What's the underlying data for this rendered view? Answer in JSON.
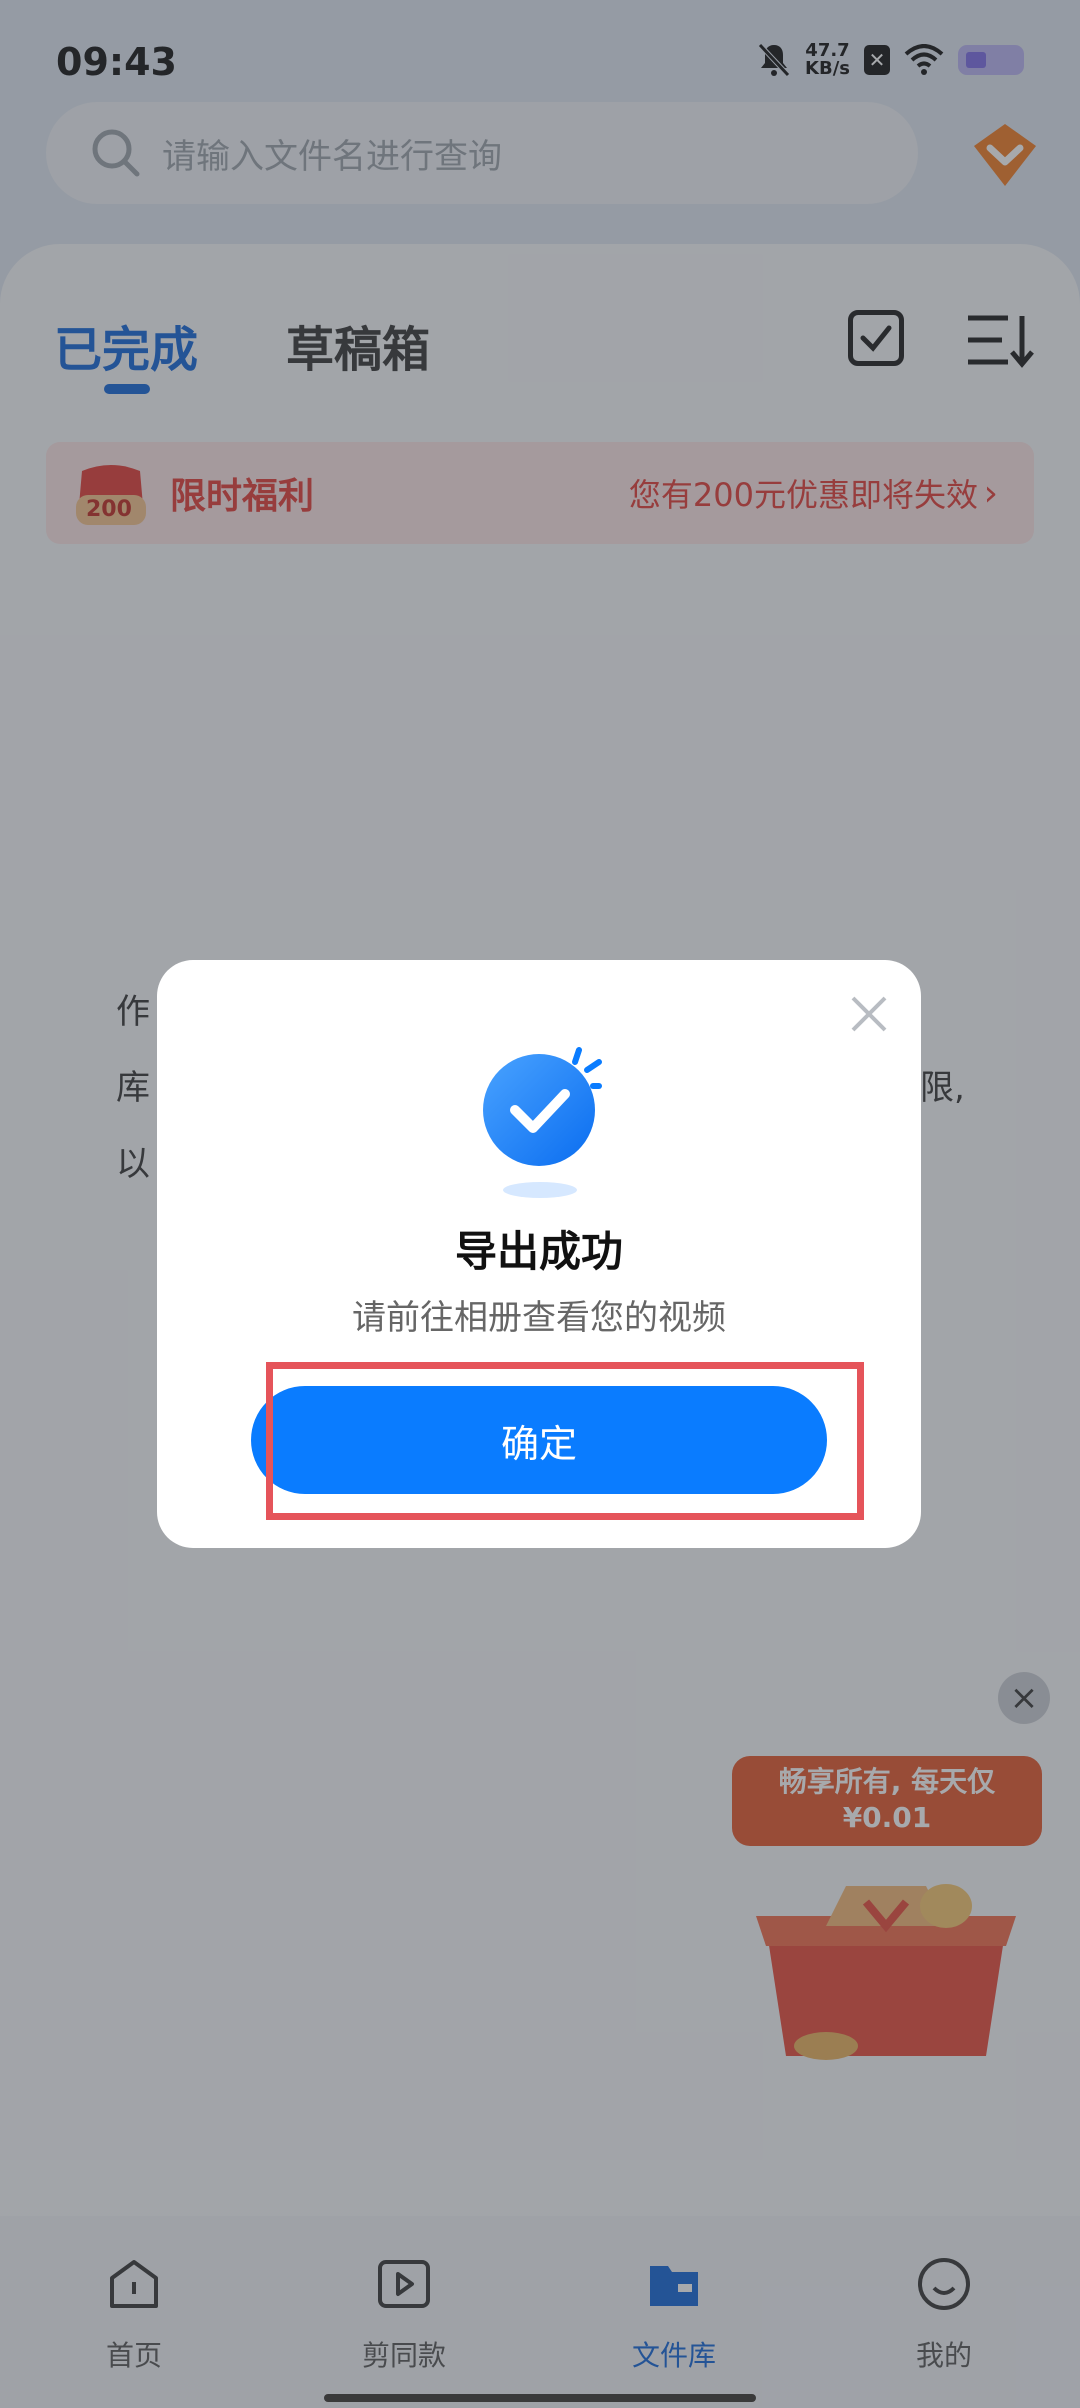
{
  "status_bar": {
    "time": "09:43",
    "net_speed_value": "47.7",
    "net_speed_unit": "KB/s"
  },
  "search": {
    "placeholder": "请输入文件名进行查询"
  },
  "tabs": [
    {
      "label": "已完成",
      "active": true
    },
    {
      "label": "草稿箱",
      "active": false
    }
  ],
  "promo": {
    "badge_value": "200",
    "title": "限时福利",
    "detail": "您有200元优惠即将失效"
  },
  "background_text": {
    "line1": "作",
    "line2_start": "库",
    "line2_end": "限,",
    "line3": "以"
  },
  "floating_ad": {
    "line1": "畅享所有, 每天仅",
    "line2": "¥0.01"
  },
  "dialog": {
    "title": "导出成功",
    "subtitle": "请前往相册查看您的视频",
    "confirm_label": "确定"
  },
  "bottom_nav": [
    {
      "label": "首页",
      "icon": "home-icon",
      "active": false
    },
    {
      "label": "剪同款",
      "icon": "video-template-icon",
      "active": false
    },
    {
      "label": "文件库",
      "icon": "folder-icon",
      "active": true
    },
    {
      "label": "我的",
      "icon": "profile-icon",
      "active": false
    }
  ],
  "colors": {
    "accent": "#0a7cff",
    "tab_active": "#1264d8",
    "promo_red": "#e23b35",
    "highlight_box": "#e5545a"
  }
}
